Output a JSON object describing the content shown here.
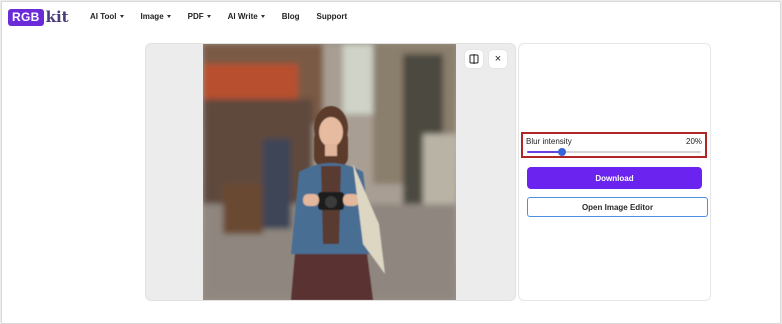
{
  "brand": {
    "box_text": "RGB",
    "suffix_text": "kit",
    "color": "#6b2bd9"
  },
  "nav": {
    "items": [
      {
        "label": "AI Tool",
        "has_dropdown": true
      },
      {
        "label": "Image",
        "has_dropdown": true
      },
      {
        "label": "PDF",
        "has_dropdown": true
      },
      {
        "label": "AI Write",
        "has_dropdown": true
      },
      {
        "label": "Blog",
        "has_dropdown": false
      },
      {
        "label": "Support",
        "has_dropdown": false
      }
    ]
  },
  "preview": {
    "toolbar": {
      "compare_icon": "split-compare-icon",
      "close_icon": "close-icon",
      "close_glyph": "×"
    }
  },
  "controls": {
    "blur_label": "Blur intensity",
    "blur_value_text": "20%",
    "blur_value": 0.2,
    "download_label": "Download",
    "editor_label": "Open Image Editor"
  },
  "colors": {
    "accent": "#6b24f0",
    "highlight_border": "#b02626",
    "editor_border": "#4d8fe0"
  }
}
